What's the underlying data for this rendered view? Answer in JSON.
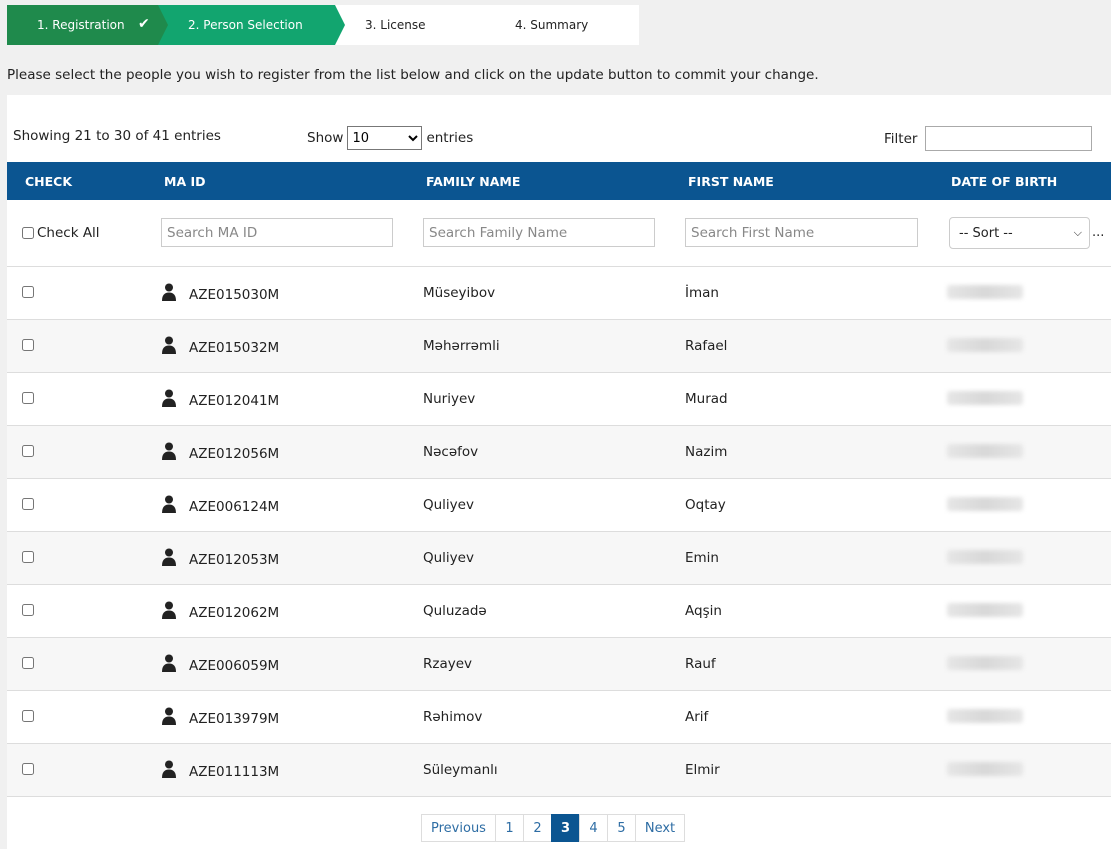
{
  "steps": [
    {
      "label": "1. Registration",
      "status": "done"
    },
    {
      "label": "2. Person Selection",
      "status": "active"
    },
    {
      "label": "3. License",
      "status": "pending"
    },
    {
      "label": "4. Summary",
      "status": "pending"
    }
  ],
  "instructions": "Please select the people you wish to register from the list below and click on the update button to commit your change.",
  "table_controls": {
    "showing": "Showing 21 to 30 of 41 entries",
    "show_label": "Show",
    "show_value": "10",
    "entries_label": "entries",
    "filter_label": "Filter",
    "filter_value": ""
  },
  "columns": [
    "CHECK",
    "MA ID",
    "FAMILY NAME",
    "FIRST NAME",
    "DATE OF BIRTH"
  ],
  "filters": {
    "check_all": "Check All",
    "ma_id_placeholder": "Search MA ID",
    "family_placeholder": "Search Family Name",
    "first_placeholder": "Search First Name",
    "sort_value": "-- Sort --",
    "overflow": "..."
  },
  "rows": [
    {
      "ma_id": "AZE015030M",
      "family": "Müseyibov",
      "first": "İman"
    },
    {
      "ma_id": "AZE015032M",
      "family": "Məhərrəmli",
      "first": "Rafael"
    },
    {
      "ma_id": "AZE012041M",
      "family": "Nuriyev",
      "first": "Murad"
    },
    {
      "ma_id": "AZE012056M",
      "family": "Nəcəfov",
      "first": "Nazim"
    },
    {
      "ma_id": "AZE006124M",
      "family": "Quliyev",
      "first": "Oqtay"
    },
    {
      "ma_id": "AZE012053M",
      "family": "Quliyev",
      "first": "Emin"
    },
    {
      "ma_id": "AZE012062M",
      "family": "Quluzadə",
      "first": "Aqşin"
    },
    {
      "ma_id": "AZE006059M",
      "family": "Rzayev",
      "first": "Rauf"
    },
    {
      "ma_id": "AZE013979M",
      "family": "Rəhimov",
      "first": "Arif"
    },
    {
      "ma_id": "AZE011113M",
      "family": "Süleymanlı",
      "first": "Elmir"
    }
  ],
  "pagination": {
    "previous": "Previous",
    "pages": [
      "1",
      "2",
      "3",
      "4",
      "5"
    ],
    "active": "3",
    "next": "Next"
  },
  "colors": {
    "step_done": "#1f8a4c",
    "step_active": "#12a56f",
    "header": "#0b5591"
  }
}
